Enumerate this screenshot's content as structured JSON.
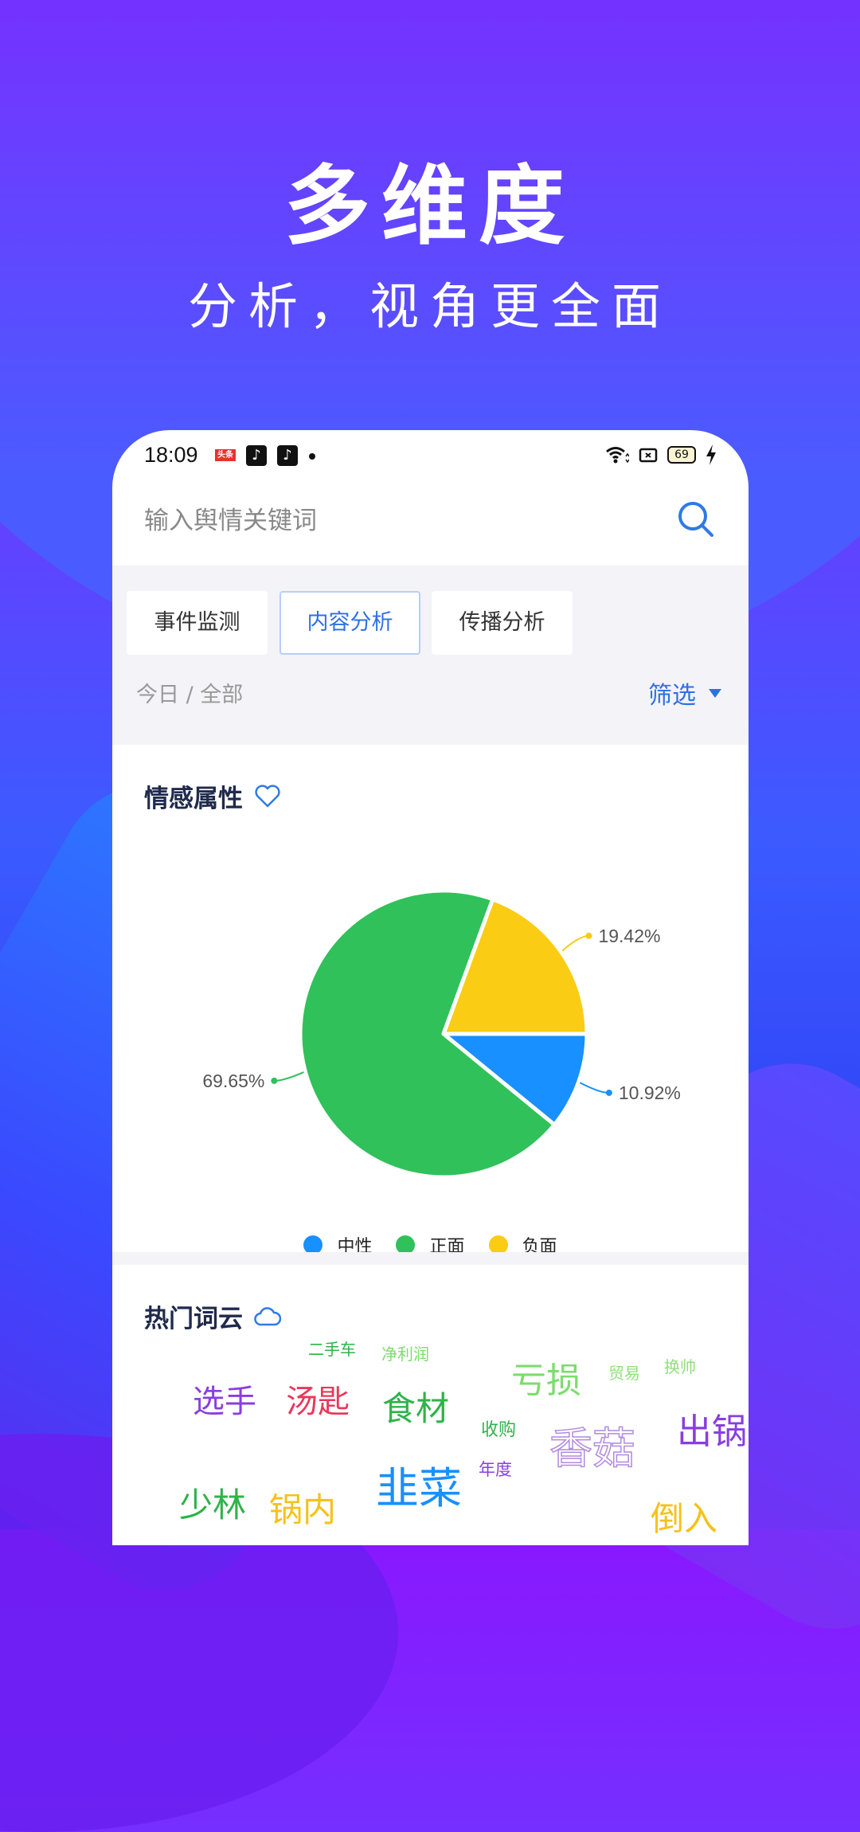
{
  "hero": {
    "title": "多维度",
    "subtitle": "分析，视角更全面"
  },
  "status_bar": {
    "time": "18:09",
    "battery": "69",
    "app_icons": [
      "toutiao-icon",
      "tiktok-icon",
      "tiktok-lite-icon"
    ]
  },
  "search": {
    "placeholder": "输入舆情关键词",
    "value": ""
  },
  "tabs": [
    {
      "label": "事件监测",
      "active": false
    },
    {
      "label": "内容分析",
      "active": true
    },
    {
      "label": "传播分析",
      "active": false
    }
  ],
  "filter_bar": {
    "breadcrumb": "今日 / 全部",
    "filter_label": "筛选"
  },
  "sentiment": {
    "title": "情感属性"
  },
  "chart_data": {
    "type": "pie",
    "title": "情感属性",
    "slices": [
      {
        "name": "中性",
        "value": 10.92,
        "label": "10.92%",
        "color": "#1890ff"
      },
      {
        "name": "正面",
        "value": 69.65,
        "label": "69.65%",
        "color": "#30c15a"
      },
      {
        "name": "负面",
        "value": 19.42,
        "label": "19.42%",
        "color": "#facc14"
      }
    ],
    "legend": [
      "中性",
      "正面",
      "负面"
    ],
    "legend_position": "bottom"
  },
  "wordcloud": {
    "title": "热门词云",
    "words": [
      {
        "text": "二手车",
        "color": "#2fb34a",
        "size": "small"
      },
      {
        "text": "净利润",
        "color": "#7ddc6e",
        "size": "small"
      },
      {
        "text": "亏损",
        "color": "#7ddc6e",
        "size": "large"
      },
      {
        "text": "贸易",
        "color": "#8fe07a",
        "size": "small"
      },
      {
        "text": "换帅",
        "color": "#8fe07a",
        "size": "small"
      },
      {
        "text": "选手",
        "color": "#8a3ee0",
        "size": "large"
      },
      {
        "text": "汤匙",
        "color": "#e8385a",
        "size": "large"
      },
      {
        "text": "食材",
        "color": "#2fb34a",
        "size": "large"
      },
      {
        "text": "收购",
        "color": "#2fb34a",
        "size": "small"
      },
      {
        "text": "香菇",
        "color": "#b28ae0",
        "size": "xlarge"
      },
      {
        "text": "出锅",
        "color": "#8a3ee0",
        "size": "large"
      },
      {
        "text": "韭菜",
        "color": "#1890ff",
        "size": "xlarge"
      },
      {
        "text": "年度",
        "color": "#8a3ee0",
        "size": "small"
      },
      {
        "text": "少林",
        "color": "#2fb34a",
        "size": "large"
      },
      {
        "text": "锅内",
        "color": "#f5c21a",
        "size": "large"
      },
      {
        "text": "倒入",
        "color": "#f5c21a",
        "size": "large"
      }
    ]
  }
}
